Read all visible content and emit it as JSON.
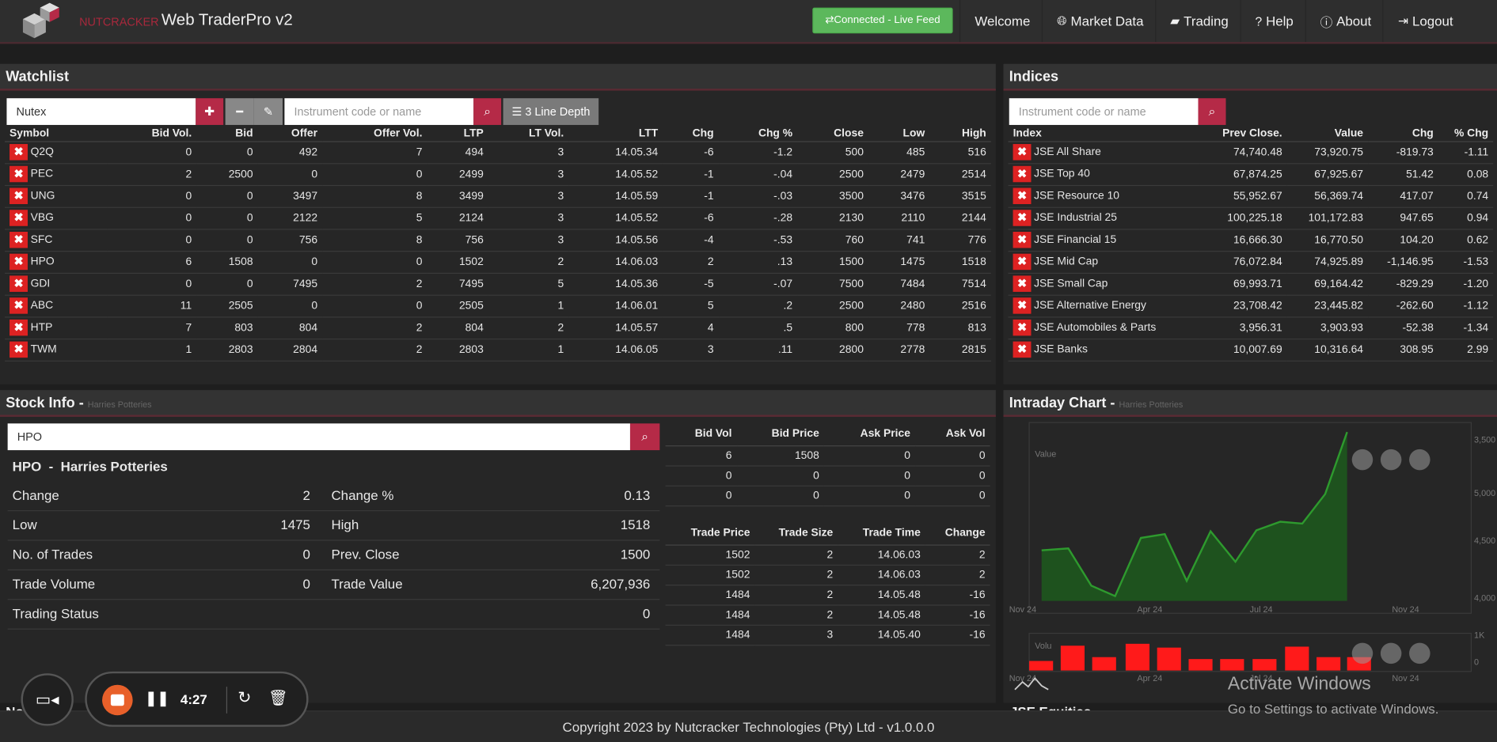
{
  "nav": {
    "brand_small": "NUTCRACKER",
    "title": "Web TraderPro v2",
    "connected": "Connected - Live Feed",
    "links": [
      {
        "icon": "",
        "label": "Welcome"
      },
      {
        "icon": "globe-icon",
        "label": "Market Data"
      },
      {
        "icon": "briefcase-icon",
        "label": "Trading"
      },
      {
        "icon": "question-icon",
        "label": "Help"
      },
      {
        "icon": "info-icon",
        "label": "About"
      },
      {
        "icon": "logout-icon",
        "label": "Logout"
      }
    ]
  },
  "watchlist": {
    "title": "Watchlist",
    "list_name": "Nutex",
    "search_placeholder": "Instrument code or name",
    "depth_label": "3 Line Depth",
    "columns": [
      "Symbol",
      "Bid Vol.",
      "Bid",
      "Offer",
      "Offer Vol.",
      "LTP",
      "LT Vol.",
      "LTT",
      "Chg",
      "Chg %",
      "Close",
      "Low",
      "High"
    ],
    "rows": [
      [
        "Q2Q",
        "0",
        "0",
        "492",
        "7",
        "494",
        "3",
        "14.05.34",
        "-6",
        "-1.2",
        "500",
        "485",
        "516"
      ],
      [
        "PEC",
        "2",
        "2500",
        "0",
        "0",
        "2499",
        "3",
        "14.05.52",
        "-1",
        "-.04",
        "2500",
        "2479",
        "2514"
      ],
      [
        "UNG",
        "0",
        "0",
        "3497",
        "8",
        "3499",
        "3",
        "14.05.59",
        "-1",
        "-.03",
        "3500",
        "3476",
        "3515"
      ],
      [
        "VBG",
        "0",
        "0",
        "2122",
        "5",
        "2124",
        "3",
        "14.05.52",
        "-6",
        "-.28",
        "2130",
        "2110",
        "2144"
      ],
      [
        "SFC",
        "0",
        "0",
        "756",
        "8",
        "756",
        "3",
        "14.05.56",
        "-4",
        "-.53",
        "760",
        "741",
        "776"
      ],
      [
        "HPO",
        "6",
        "1508",
        "0",
        "0",
        "1502",
        "2",
        "14.06.03",
        "2",
        ".13",
        "1500",
        "1475",
        "1518"
      ],
      [
        "GDI",
        "0",
        "0",
        "7495",
        "2",
        "7495",
        "5",
        "14.05.36",
        "-5",
        "-.07",
        "7500",
        "7484",
        "7514"
      ],
      [
        "ABC",
        "11",
        "2505",
        "0",
        "0",
        "2505",
        "1",
        "14.06.01",
        "5",
        ".2",
        "2500",
        "2480",
        "2516"
      ],
      [
        "HTP",
        "7",
        "803",
        "804",
        "2",
        "804",
        "2",
        "14.05.57",
        "4",
        ".5",
        "800",
        "778",
        "813"
      ],
      [
        "TWM",
        "1",
        "2803",
        "2804",
        "2",
        "2803",
        "1",
        "14.06.05",
        "3",
        ".11",
        "2800",
        "2778",
        "2815"
      ]
    ]
  },
  "indices": {
    "title": "Indices",
    "search_placeholder": "Instrument code or name",
    "columns": [
      "Index",
      "Prev Close.",
      "Value",
      "Chg",
      "% Chg"
    ],
    "rows": [
      [
        "JSE All Share",
        "74,740.48",
        "73,920.75",
        "-819.73",
        "-1.11"
      ],
      [
        "JSE Top 40",
        "67,874.25",
        "67,925.67",
        "51.42",
        "0.08"
      ],
      [
        "JSE Resource 10",
        "55,952.67",
        "56,369.74",
        "417.07",
        "0.74"
      ],
      [
        "JSE Industrial 25",
        "100,225.18",
        "101,172.83",
        "947.65",
        "0.94"
      ],
      [
        "JSE Financial 15",
        "16,666.30",
        "16,770.50",
        "104.20",
        "0.62"
      ],
      [
        "JSE Mid Cap",
        "76,072.84",
        "74,925.89",
        "-1,146.95",
        "-1.53"
      ],
      [
        "JSE Small Cap",
        "69,993.71",
        "69,164.42",
        "-829.29",
        "-1.20"
      ],
      [
        "JSE Alternative Energy",
        "23,708.42",
        "23,445.82",
        "-262.60",
        "-1.12"
      ],
      [
        "JSE Automobiles & Parts",
        "3,956.31",
        "3,903.93",
        "-52.38",
        "-1.34"
      ],
      [
        "JSE Banks",
        "10,007.69",
        "10,316.64",
        "308.95",
        "2.99"
      ]
    ]
  },
  "stock_info": {
    "title": "Stock Info -",
    "subtitle": "Harries Potteries",
    "search_value": "HPO",
    "heading": "HPO  -  Harries Potteries",
    "rows": [
      {
        "l1": "Change",
        "v1": "2",
        "l2": "Change %",
        "v2": "0.13"
      },
      {
        "l1": "Low",
        "v1": "1475",
        "l2": "High",
        "v2": "1518"
      },
      {
        "l1": "No. of Trades",
        "v1": "0",
        "l2": "Prev. Close",
        "v2": "1500"
      },
      {
        "l1": "Trade Volume",
        "v1": "0",
        "l2": "Trade Value",
        "v2": "6,207,936"
      },
      {
        "l1": "Trading Status",
        "v1": "",
        "l2": "",
        "v2": "0"
      }
    ],
    "depth_columns": [
      "Bid Vol",
      "Bid Price",
      "Ask Price",
      "Ask Vol"
    ],
    "depth_rows": [
      [
        "6",
        "1508",
        "0",
        "0"
      ],
      [
        "0",
        "0",
        "0",
        "0"
      ],
      [
        "0",
        "0",
        "0",
        "0"
      ]
    ],
    "trade_columns": [
      "Trade Price",
      "Trade Size",
      "Trade Time",
      "Change"
    ],
    "trade_rows": [
      [
        "1502",
        "2",
        "14.06.03",
        "2"
      ],
      [
        "1502",
        "2",
        "14.06.03",
        "2"
      ],
      [
        "1484",
        "2",
        "14.05.48",
        "-16"
      ],
      [
        "1484",
        "2",
        "14.05.48",
        "-16"
      ],
      [
        "1484",
        "3",
        "14.05.40",
        "-16"
      ]
    ]
  },
  "intraday": {
    "title": "Intraday Chart -",
    "subtitle": "Harries Potteries"
  },
  "chart_data": {
    "type": "area",
    "y_axis_ticks": [
      "3,500",
      "5,000",
      "4,500",
      "4,000"
    ],
    "x_axis_ticks": [
      "Nov 24",
      "Apr 24",
      "Jul 24",
      "Nov 24"
    ],
    "series_label": "Value",
    "volume_label": "Volu",
    "volume_tick": "1K",
    "volume_zero": "0",
    "colors": {
      "line": "#2e9a2e",
      "fill": "#1d5a1d",
      "volume": "#ff1a1a"
    }
  },
  "footer": {
    "copyright": "Copyright 2023 by Nutcracker Technologies (Pty) Ltd - v1.0.0.0",
    "left_tab": "Nou",
    "right_tab": "JSE Equities"
  },
  "recorder": {
    "time": "4:27"
  },
  "watermark": {
    "line1": "Activate Windows",
    "line2": "Go to Settings to activate Windows."
  }
}
